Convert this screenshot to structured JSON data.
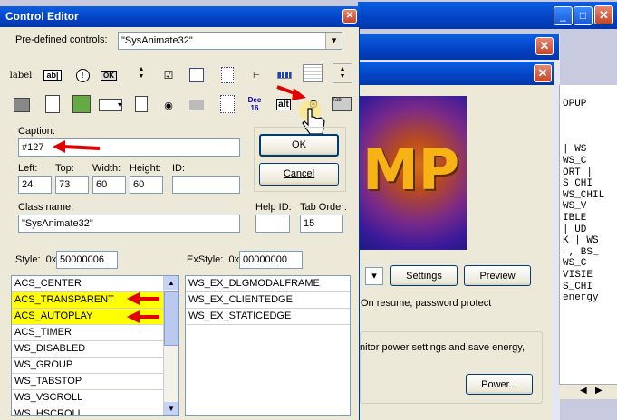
{
  "editor": {
    "title": "Control Editor",
    "predefined_label": "Pre-defined controls:",
    "predefined_value": "\"SysAnimate32\"",
    "toolbar_row1": [
      "label",
      "ab|",
      "!",
      "OK",
      "",
      "",
      "",
      "",
      "",
      "",
      "",
      ""
    ],
    "toolbar_row2": [
      "",
      "",
      "",
      "",
      "",
      "",
      "",
      "Dec 16",
      "alt",
      "",
      "Tab"
    ],
    "caption_label": "Caption:",
    "caption_value": "#127",
    "left_label": "Left:",
    "left_value": "24",
    "top_label": "Top:",
    "top_value": "73",
    "width_label": "Width:",
    "width_value": "60",
    "height_label": "Height:",
    "height_value": "60",
    "id_label": "ID:",
    "id_value": "",
    "ok_label": "OK",
    "cancel_label": "Cancel",
    "classname_label": "Class name:",
    "classname_value": "\"SysAnimate32\"",
    "helpid_label": "Help ID:",
    "helpid_value": "",
    "taborder_label": "Tab Order:",
    "taborder_value": "15",
    "style_label": "Style:",
    "style_prefix": "0x",
    "style_value": "50000006",
    "exstyle_label": "ExStyle:",
    "exstyle_prefix": "0x",
    "exstyle_value": "00000000",
    "styles": [
      "ACS_CENTER",
      "ACS_TRANSPARENT",
      "ACS_AUTOPLAY",
      "ACS_TIMER",
      "WS_DISABLED",
      "WS_GROUP",
      "WS_TABSTOP",
      "WS_VSCROLL",
      "WS_HSCROLL"
    ],
    "exstyles": [
      "WS_EX_DLGMODALFRAME",
      "WS_EX_CLIENTEDGE",
      "WS_EX_STATICEDGE"
    ]
  },
  "background": {
    "settings_label": "Settings",
    "preview_label": "Preview",
    "resume_text": "On resume, password protect",
    "monitor_text": "nitor power settings and save energy,",
    "power_label": "Power...",
    "logo_text": "MP",
    "code_lines": [
      "OPUP",
      "",
      "",
      "",
      "| WS",
      "WS_C",
      "ORT |",
      "S_CHI",
      "WS_CHIL",
      "WS_V",
      "IBLE",
      "| UD",
      "K | WS",
      "←, BS_",
      "WS_C",
      "VISIE",
      "S_CHI",
      "energy"
    ]
  },
  "colors": {
    "highlight": "#ffff00",
    "arrow": "#e00000",
    "xp_blue": "#0a5fe0"
  }
}
